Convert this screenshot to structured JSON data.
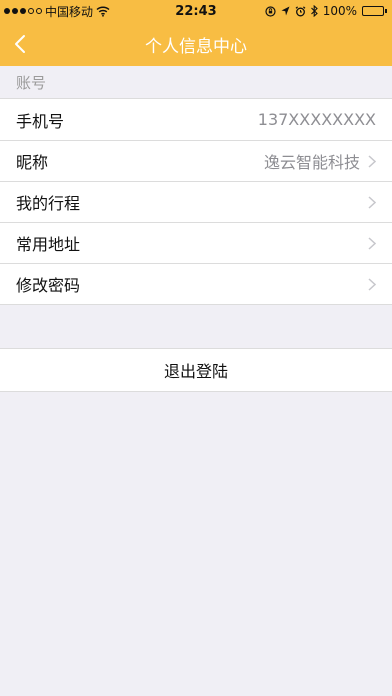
{
  "status_bar": {
    "carrier": "中国移动",
    "time": "22:43",
    "battery": "100%",
    "battery_level": 1.0,
    "icons": [
      "signal-dots-icon",
      "wifi-icon",
      "rotation-lock-icon",
      "location-arrow-icon",
      "alarm-icon",
      "bluetooth-icon",
      "battery-icon"
    ]
  },
  "nav": {
    "title": "个人信息中心",
    "back_icon": "chevron-left-icon"
  },
  "account_section": {
    "header": "账号",
    "rows": [
      {
        "label": "手机号",
        "value": "137XXXXXXXX",
        "has_chevron": false
      },
      {
        "label": "昵称",
        "value": "逸云智能科技",
        "has_chevron": true
      },
      {
        "label": "我的行程",
        "value": "",
        "has_chevron": true
      },
      {
        "label": "常用地址",
        "value": "",
        "has_chevron": true
      },
      {
        "label": "修改密码",
        "value": "",
        "has_chevron": true
      }
    ]
  },
  "logout_label": "退出登陆",
  "colors": {
    "accent": "#f8bd43",
    "background": "#f0eff5",
    "secondary_text": "#8e8e93",
    "header_text": "#9b9b9b"
  }
}
